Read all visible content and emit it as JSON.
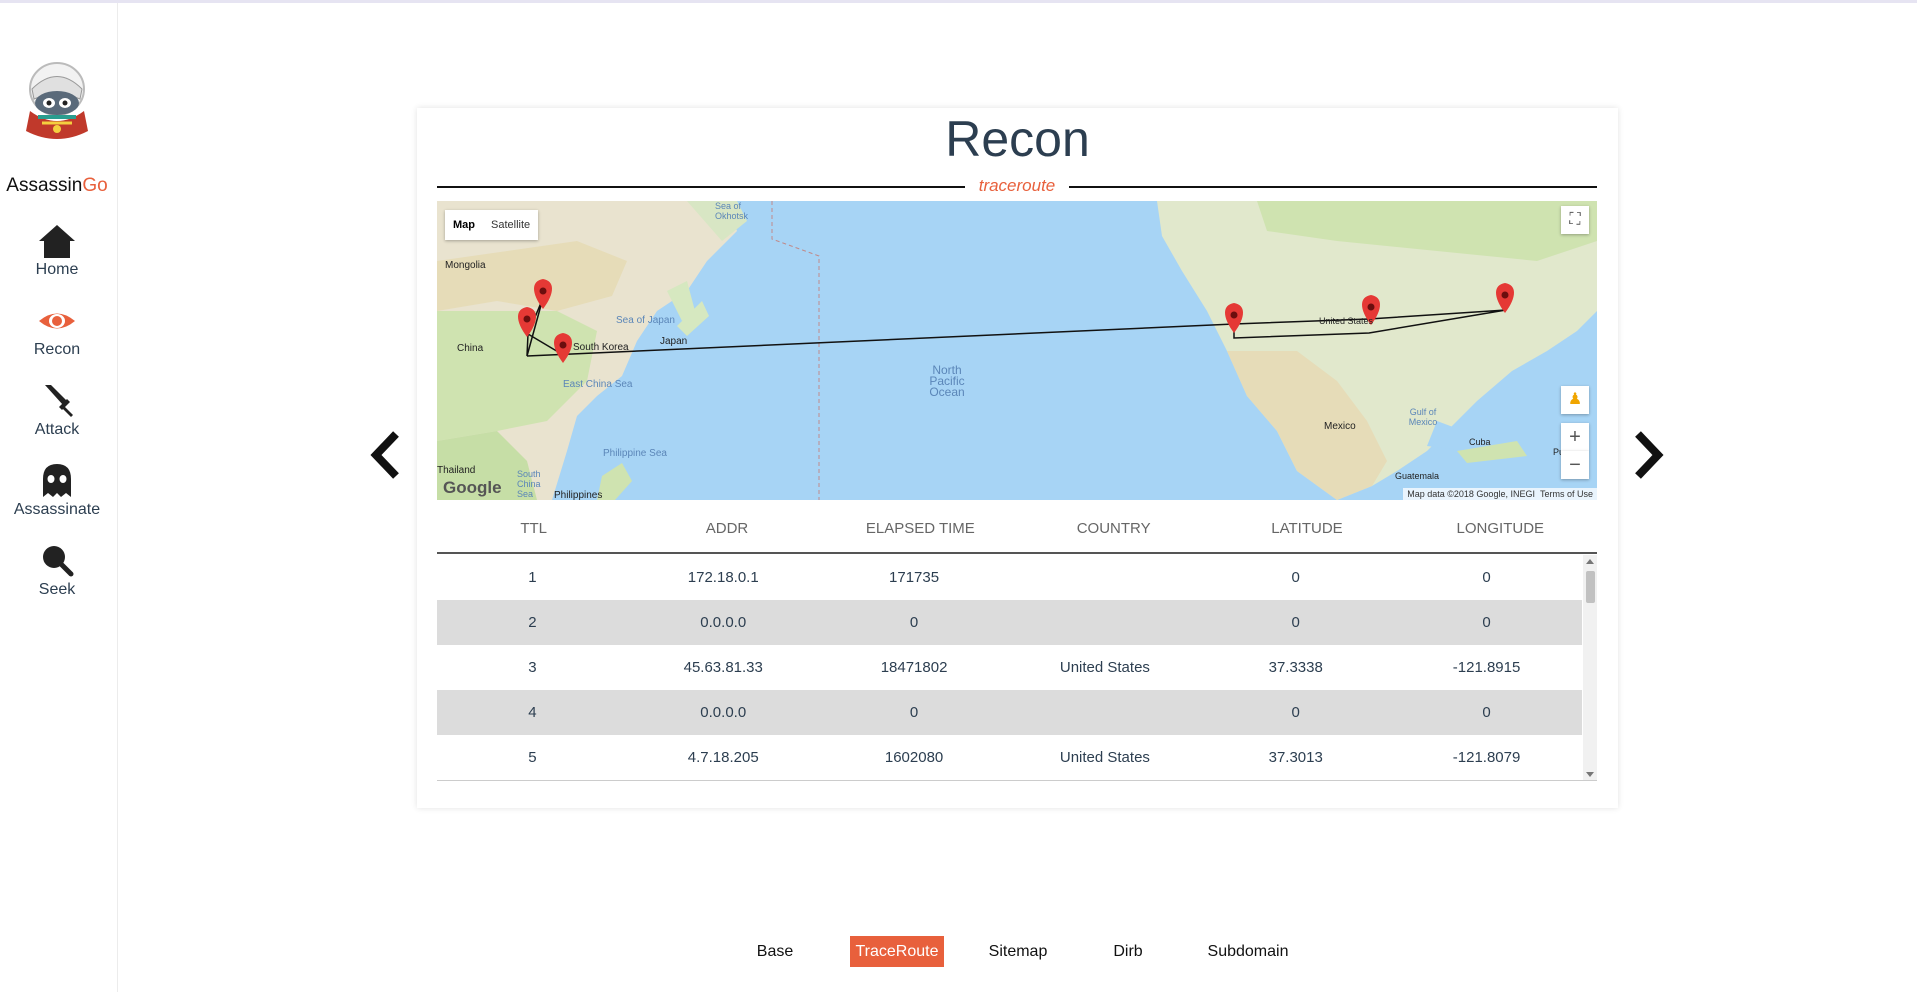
{
  "brand": {
    "name_prefix": "Assassin",
    "name_suffix": "Go"
  },
  "sidebar": {
    "items": [
      {
        "label": "Home",
        "icon": "home-icon"
      },
      {
        "label": "Recon",
        "icon": "eye-icon",
        "active": true
      },
      {
        "label": "Attack",
        "icon": "sword-icon"
      },
      {
        "label": "Assassinate",
        "icon": "ghost-icon"
      },
      {
        "label": "Seek",
        "icon": "search-icon"
      }
    ]
  },
  "page": {
    "title": "Recon",
    "subtitle": "traceroute"
  },
  "map": {
    "type_options": [
      "Map",
      "Satellite"
    ],
    "selected_type": "Map",
    "attribution": "Map data ©2018 Google, INEGI",
    "terms": "Terms of Use",
    "google_logo": "Google",
    "labels": [
      "Mongolia",
      "China",
      "South Korea",
      "Japan",
      "Sea of Japan",
      "Sea of Okhotsk",
      "East China Sea",
      "Philippine Sea",
      "Philippines",
      "Thailand",
      "South China Sea",
      "North Pacific Ocean",
      "United States",
      "Mexico",
      "Gulf of Mexico",
      "Cuba",
      "Guatemala",
      "Puerto R"
    ],
    "zoom_in": "+",
    "zoom_out": "−"
  },
  "table": {
    "headers": [
      "TTL",
      "ADDR",
      "ELAPSED TIME",
      "COUNTRY",
      "LATITUDE",
      "LONGITUDE"
    ],
    "rows": [
      [
        "1",
        "172.18.0.1",
        "171735",
        "",
        "0",
        "0"
      ],
      [
        "2",
        "0.0.0.0",
        "0",
        "",
        "0",
        "0"
      ],
      [
        "3",
        "45.63.81.33",
        "18471802",
        "United States",
        "37.3338",
        "-121.8915"
      ],
      [
        "4",
        "0.0.0.0",
        "0",
        "",
        "0",
        "0"
      ],
      [
        "5",
        "4.7.18.205",
        "1602080",
        "United States",
        "37.3013",
        "-121.8079"
      ]
    ]
  },
  "tabs": [
    "Base",
    "TraceRoute",
    "Sitemap",
    "Dirb",
    "Subdomain"
  ],
  "active_tab": "TraceRoute",
  "colors": {
    "accent": "#e8603c",
    "title": "#2c3e50",
    "water": "#a7d4f5"
  }
}
